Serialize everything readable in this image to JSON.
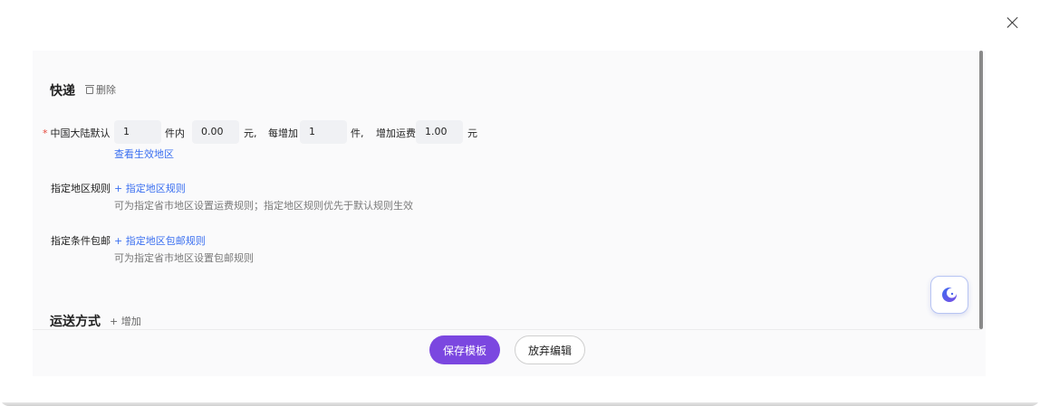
{
  "section_express": {
    "title": "快递",
    "delete_label": "删除"
  },
  "mainland_rule": {
    "label": "中国大陆默认",
    "first_qty": "1",
    "first_qty_unit": "件内",
    "first_fee": "0.00",
    "first_fee_unit": "元,",
    "add_label": "每增加",
    "add_qty": "1",
    "add_qty_unit": "件,",
    "add_fee_label": "增加运费",
    "add_fee": "1.00",
    "add_fee_unit": "元",
    "view_regions_link": "查看生效地区"
  },
  "region_rule": {
    "label": "指定地区规则",
    "add_link": "+ 指定地区规则",
    "hint": "可为指定省市地区设置运费规则；指定地区规则优先于默认规则生效"
  },
  "free_shipping_rule": {
    "label": "指定条件包邮",
    "add_link": "+ 指定地区包邮规则",
    "hint": "可为指定省市地区设置包邮规则"
  },
  "section_delivery": {
    "title": "运送方式",
    "add_label": "+ 增加"
  },
  "footer": {
    "save_label": "保存模板",
    "discard_label": "放弃编辑"
  },
  "colors": {
    "primary": "#7b47e0",
    "link": "#3a6ff0",
    "required": "#e5483c"
  },
  "icons": [
    "close-icon",
    "trash-icon",
    "moon-icon"
  ]
}
